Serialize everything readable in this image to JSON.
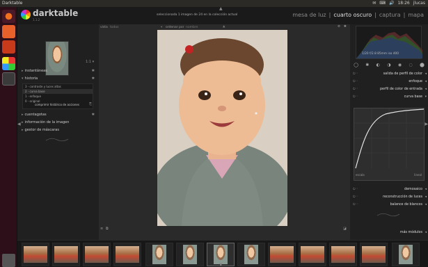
{
  "system": {
    "window_title": "Darktable",
    "tray": [
      "✉",
      "⌨",
      "🔊",
      "18:26",
      "jlucas"
    ]
  },
  "app": {
    "brand": "darktable",
    "version": "1.1.2",
    "selection_info": "seleccionada 1 imagen de 24 en la colección actual",
    "views": [
      {
        "label": "mesa de luz",
        "active": false
      },
      {
        "label": "|",
        "active": false
      },
      {
        "label": "cuarto oscuro",
        "active": true
      },
      {
        "label": "|",
        "active": false
      },
      {
        "label": "captura",
        "active": false
      },
      {
        "label": "|",
        "active": false
      },
      {
        "label": "mapa",
        "active": false
      }
    ]
  },
  "left": {
    "sections": [
      "instantáneas",
      "historia",
      "cuentagotas",
      "información de la imagen",
      "gestor de máscaras"
    ],
    "history": [
      {
        "label": "3 - contraste y luces altas",
        "selected": false
      },
      {
        "label": "2 - curva base",
        "selected": true
      },
      {
        "label": "1 - enfoque",
        "selected": false
      },
      {
        "label": "0 - original",
        "selected": false
      }
    ],
    "compress_button": "comprimir histórico de acciones"
  },
  "center": {
    "filter_label": "vista",
    "filter_value": "todos",
    "sort_label": "ordenar por",
    "sort_value": "nombre"
  },
  "right": {
    "histogram_info": "1/20 f/2.8 85mm iso 400",
    "module_groups": [
      "◯",
      "✱",
      "◐",
      "◑",
      "◉",
      "◌",
      "⬤"
    ],
    "modules_top": [
      {
        "name": "salida de perfil de color"
      },
      {
        "name": "enfoque"
      },
      {
        "name": "perfil de color de entrada"
      },
      {
        "name": "curva base"
      }
    ],
    "curve_left": "escala",
    "curve_right": "lineal",
    "modules_bottom": [
      {
        "name": "demosaico"
      },
      {
        "name": "reconstrucción de luces"
      },
      {
        "name": "balance de blancos"
      }
    ],
    "more_modules": "más módulos"
  },
  "filmstrip": {
    "count": 13
  }
}
